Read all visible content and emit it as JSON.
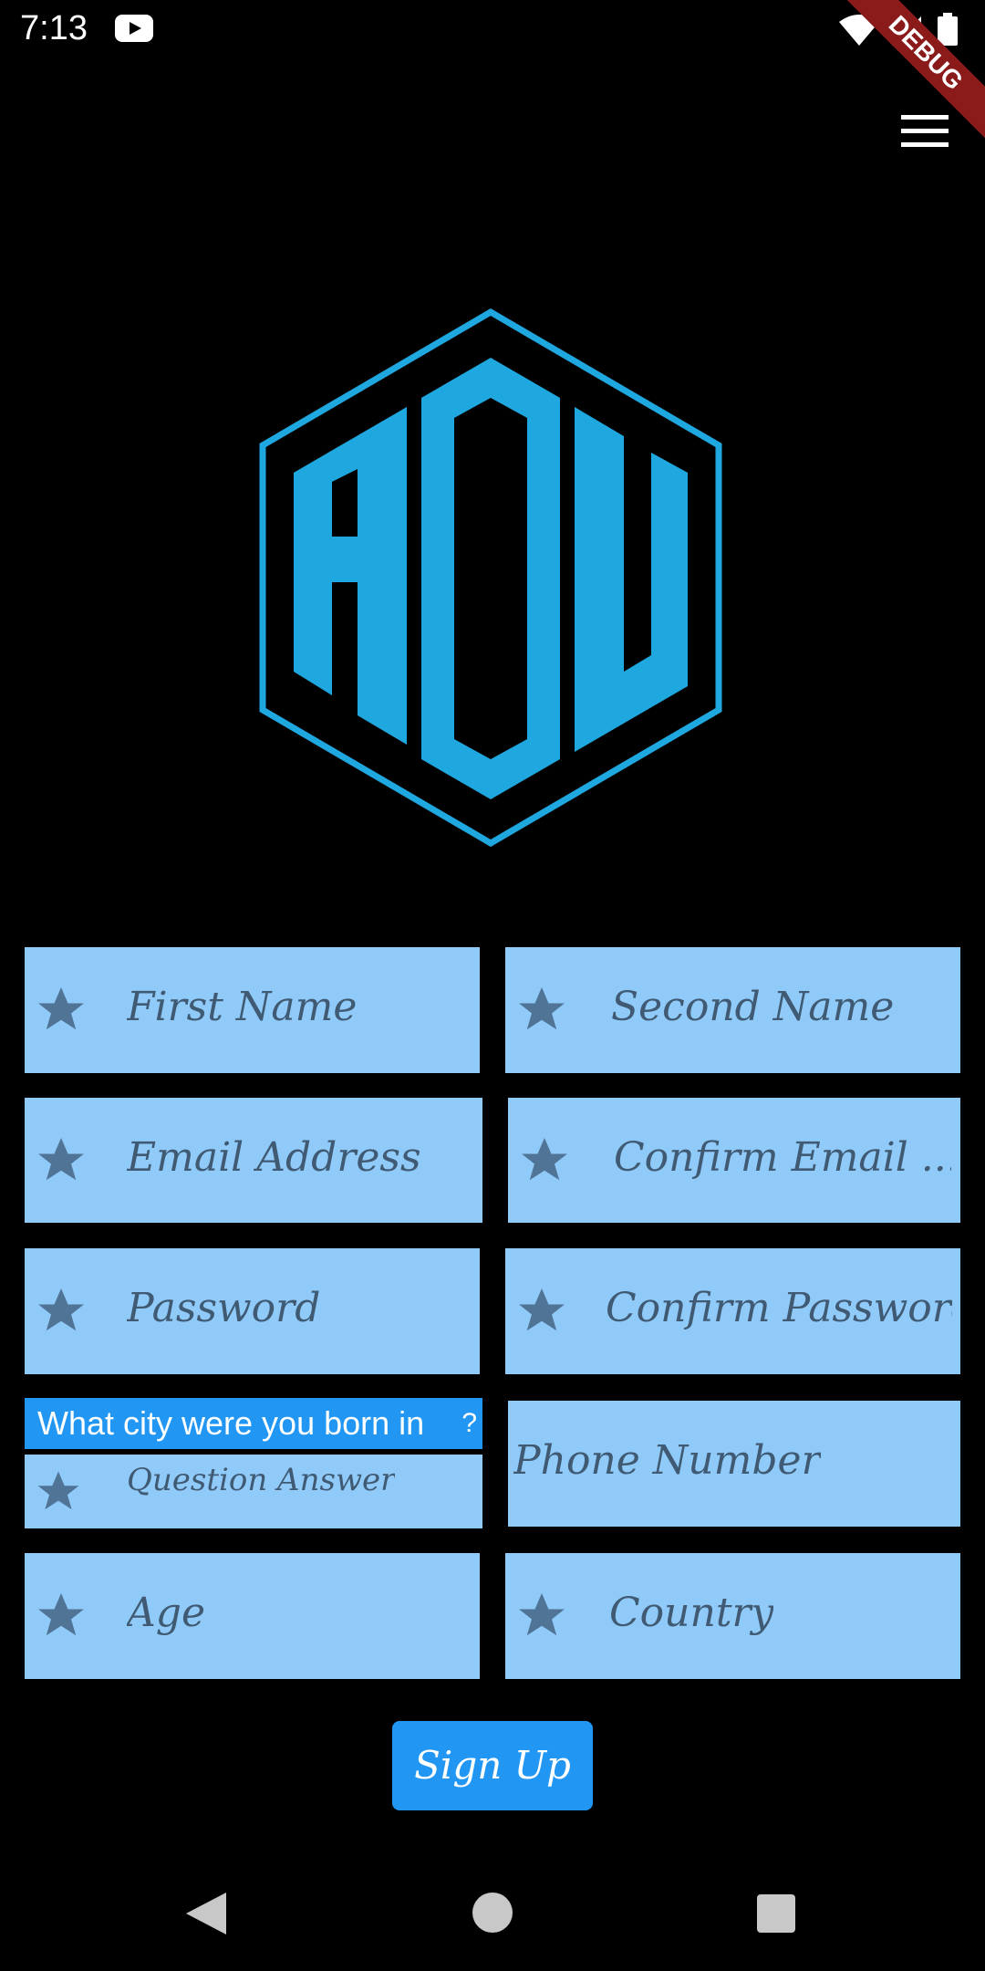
{
  "status_bar": {
    "time": "7:13",
    "icons": [
      "youtube-icon",
      "wifi-icon",
      "signal-icon",
      "battery-icon"
    ]
  },
  "debug_banner": "DEBUG",
  "menu": {
    "icon": "hamburger-menu-icon"
  },
  "logo": {
    "text": "ADU",
    "color": "#1fa8e0"
  },
  "form": {
    "first_name": {
      "placeholder": "First Name",
      "icon": "star-icon"
    },
    "second_name": {
      "placeholder": "Second Name",
      "icon": "star-icon"
    },
    "email": {
      "placeholder": "Email Address",
      "icon": "star-icon"
    },
    "confirm_email": {
      "placeholder": "Confirm Email ...",
      "icon": "star-icon"
    },
    "password": {
      "placeholder": "Password",
      "icon": "star-icon"
    },
    "confirm_password": {
      "placeholder": "Confirm Password",
      "icon": "star-icon"
    },
    "security_question": {
      "selected": "What city were you born in",
      "suffix": "?"
    },
    "question_answer": {
      "placeholder": "Question Answer",
      "icon": "star-icon"
    },
    "phone": {
      "placeholder": "Phone Number"
    },
    "age": {
      "placeholder": "Age",
      "icon": "star-icon"
    },
    "country": {
      "placeholder": "Country",
      "icon": "star-icon"
    }
  },
  "signup_button": {
    "label": "Sign Up"
  },
  "colors": {
    "background": "#000000",
    "field": "#90caf9",
    "placeholder": "#3f5a72",
    "accent": "#2196f3"
  },
  "nav_bar": {
    "icons": [
      "back-icon",
      "home-icon",
      "recents-icon"
    ]
  }
}
